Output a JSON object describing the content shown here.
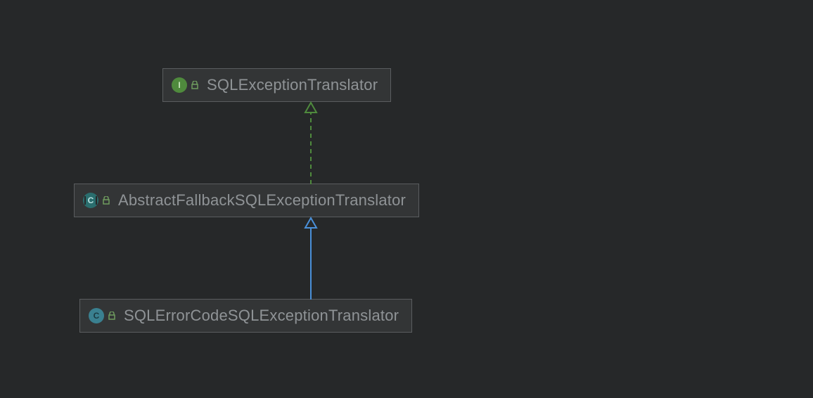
{
  "nodes": {
    "n0": {
      "label": "SQLExceptionTranslator",
      "type_letter": "I"
    },
    "n1": {
      "label": "AbstractFallbackSQLExceptionTranslator",
      "type_letter": "C"
    },
    "n2": {
      "label": "SQLErrorCodeSQLExceptionTranslator",
      "type_letter": "C"
    }
  },
  "colors": {
    "implements_arrow": "#4f8a3d",
    "extends_arrow": "#4a90d9"
  }
}
